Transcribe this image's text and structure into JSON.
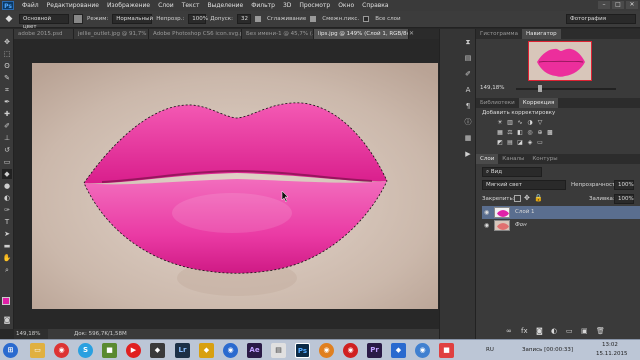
{
  "app": {
    "logo": "Ps"
  },
  "menu": [
    "Файл",
    "Редактирование",
    "Изображение",
    "Слои",
    "Текст",
    "Выделение",
    "Фильтр",
    "3D",
    "Просмотр",
    "Окно",
    "Справка"
  ],
  "window_buttons": [
    "–",
    "□",
    "✕"
  ],
  "options": {
    "preset": "Основной цвет",
    "mode_label": "Режим:",
    "mode_value": "Нормальный",
    "opacity_label": "Непрозр.:",
    "opacity_value": "100%",
    "tolerance_label": "Допуск:",
    "tolerance_value": "32",
    "antialias_label": "Сглаживание",
    "contiguous_label": "Смежн.пикс.",
    "all_layers_label": "Все слои",
    "workspace": "Фотография"
  },
  "doc_tabs": [
    "adobe 2015.psd",
    "jellie_outlet.jpg @ 91,7% ...",
    "Adobe Photoshop CS6 icon.svg.png",
    "Без имени-1 @ 45,7% (...",
    "lips.jpg @ 149% (Слой 1, RGB/8#)"
  ],
  "active_tab_index": 4,
  "status": {
    "zoom": "149,18%",
    "doc_size": "Док: 596,7K/1,58M"
  },
  "panels": {
    "nav_tabs": [
      "Гистограмма",
      "Навигатор"
    ],
    "nav_zoom": "149,18%",
    "adj_tabs": [
      "Библиотеки",
      "Коррекция"
    ],
    "adj_title": "Добавить корректировку",
    "layers_tabs": [
      "Слои",
      "Каналы",
      "Контуры"
    ],
    "kind_filter": "Вид",
    "blend_mode": "Мягкий свет",
    "opacity_label": "Непрозрачность:",
    "opacity_value": "100%",
    "lock_label": "Закрепить:",
    "fill_label": "Заливка:",
    "fill_value": "100%",
    "layers": [
      {
        "name": "Слой 1",
        "selected": true
      },
      {
        "name": "Фон",
        "selected": false
      }
    ]
  },
  "tray": {
    "lang": "RU",
    "recording": "Запись [00:00:33]",
    "time": "13:02",
    "date": "15.11.2015"
  },
  "colors": {
    "lip_pink": "#ec2e9c",
    "foreground": "#e020a8",
    "selected_layer": "#5a6e8f"
  }
}
